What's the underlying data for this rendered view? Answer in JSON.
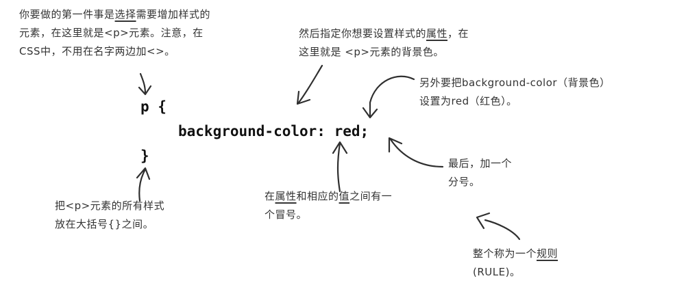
{
  "code": {
    "selector_line": "p {",
    "declaration": "background-color: red;",
    "close_brace": "}"
  },
  "annotations": {
    "selector_note": {
      "line1_pre": "你要做的第一件事是",
      "line1_u": "选择",
      "line1_post": "需要增加样式的",
      "line2": "元素，在这里就是<p>元素。注意，在",
      "line3": "CSS中，不用在名字两边加<>。"
    },
    "property_note": {
      "line1_pre": "然后指定你想要设置样式的",
      "line1_u": "属性",
      "line1_post": "，在",
      "line2": "这里就是 <p>元素的背景色。"
    },
    "value_note": {
      "line1": "另外要把background-color（背景色）",
      "line2": "设置为red（红色）。"
    },
    "semicolon_note": {
      "line1": "最后，加一个",
      "line2": "分号。"
    },
    "colon_note": {
      "line1_pre": "在",
      "line1_u1": "属性",
      "line1_mid": "和相应的",
      "line1_u2": "值",
      "line1_post": "之间有一",
      "line2": "个冒号。"
    },
    "braces_note": {
      "line1": "把<p>元素的所有样式",
      "line2": "放在大括号{}之间。"
    },
    "rule_note": {
      "line1_pre": "整个称为一个",
      "line1_u": "规则",
      "line2": "(RULE)。"
    }
  }
}
